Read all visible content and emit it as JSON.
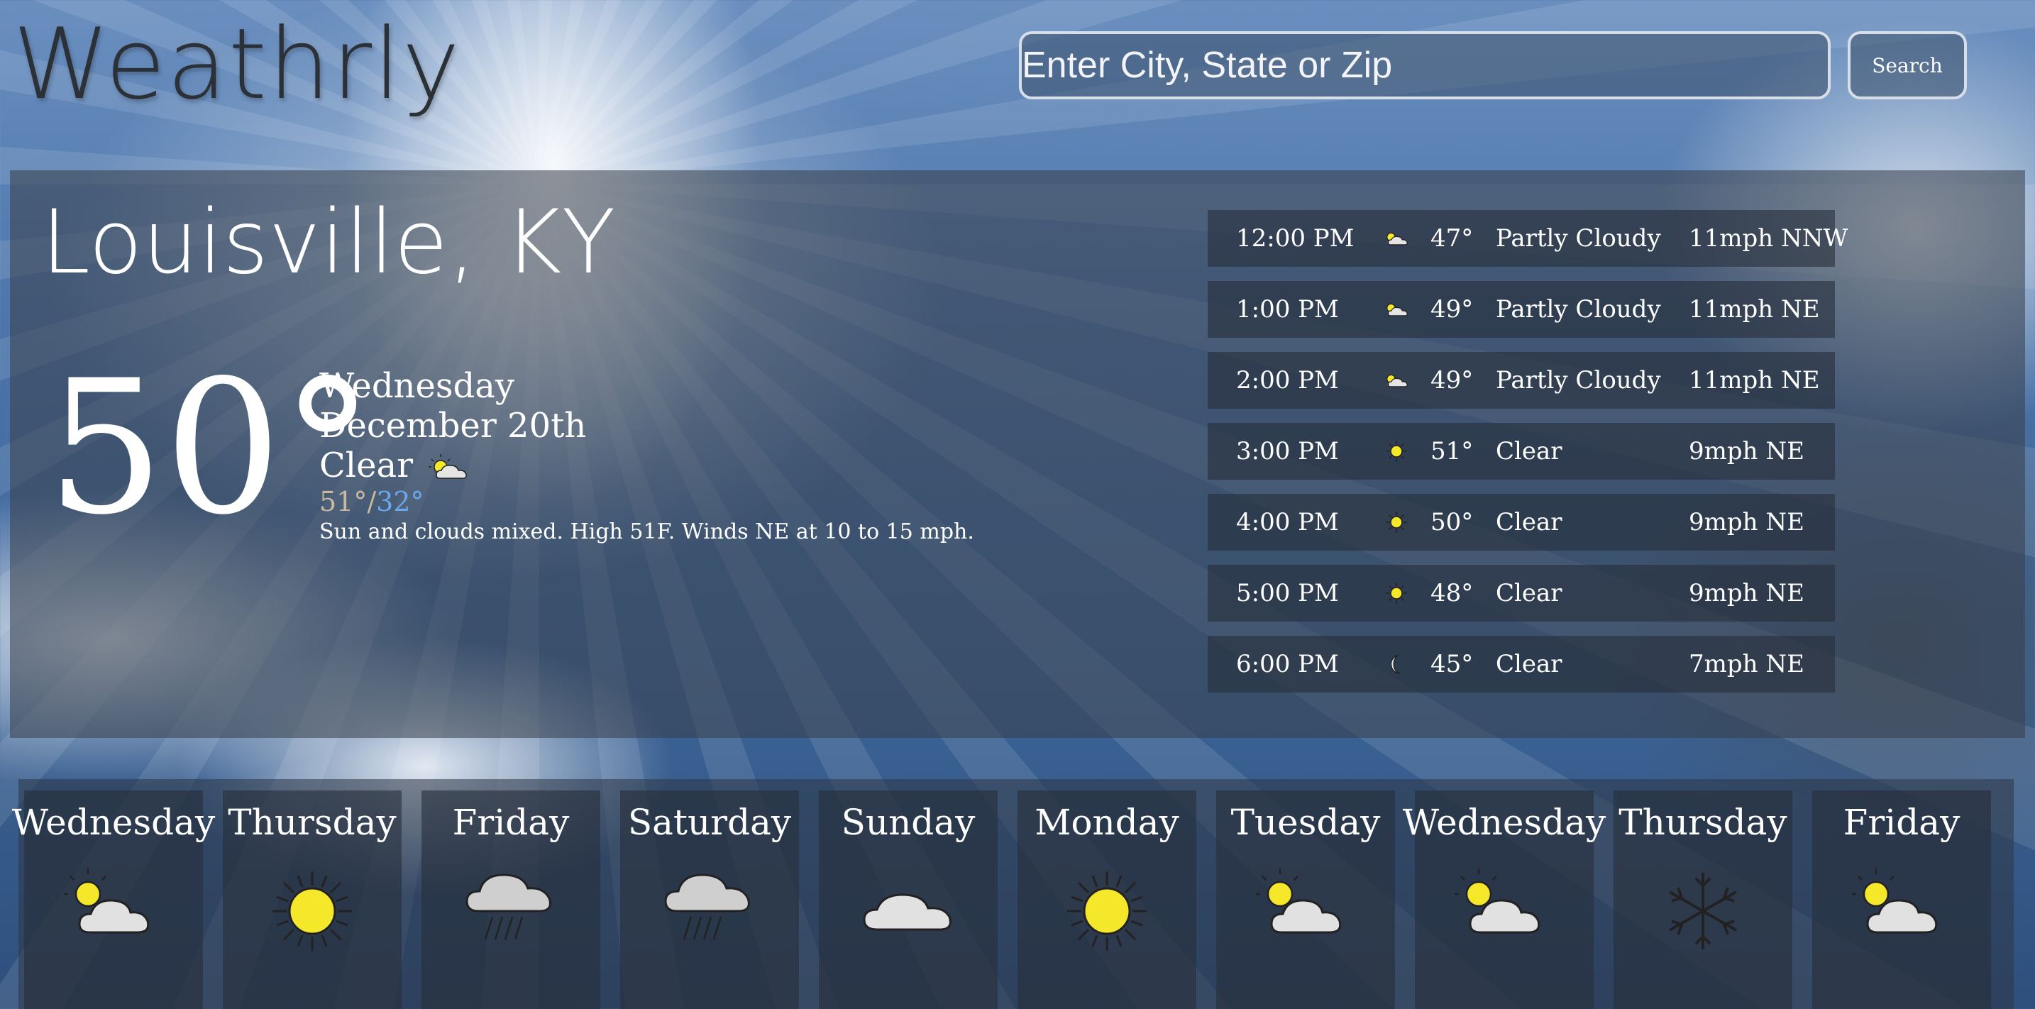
{
  "app": {
    "logo": "Weathrly"
  },
  "search": {
    "placeholder": "Enter City, State or Zip",
    "button_label": "Search"
  },
  "current": {
    "location": "Louisville, KY",
    "temperature": "50°",
    "weekday": "Wednesday",
    "date": "December 20th",
    "condition": "Clear",
    "condition_icon": "partly-cloudy-icon",
    "high": "51°",
    "separator": "/",
    "low": "32°",
    "summary": "Sun and clouds mixed. High 51F. Winds NE at 10 to 15 mph."
  },
  "colors": {
    "high": "#c9b99e",
    "low": "#6aa8ec",
    "logo": "#2c3138"
  },
  "hourly": [
    {
      "time": "12:00 PM",
      "icon": "partly-cloudy-icon",
      "temp": "47°",
      "condition": "Partly Cloudy",
      "wind": "11mph NNW"
    },
    {
      "time": "1:00 PM",
      "icon": "partly-cloudy-icon",
      "temp": "49°",
      "condition": "Partly Cloudy",
      "wind": "11mph NE"
    },
    {
      "time": "2:00 PM",
      "icon": "partly-cloudy-icon",
      "temp": "49°",
      "condition": "Partly Cloudy",
      "wind": "11mph NE"
    },
    {
      "time": "3:00 PM",
      "icon": "sun-icon",
      "temp": "51°",
      "condition": "Clear",
      "wind": "9mph NE"
    },
    {
      "time": "4:00 PM",
      "icon": "sun-icon",
      "temp": "50°",
      "condition": "Clear",
      "wind": "9mph NE"
    },
    {
      "time": "5:00 PM",
      "icon": "sun-icon",
      "temp": "48°",
      "condition": "Clear",
      "wind": "9mph NE"
    },
    {
      "time": "6:00 PM",
      "icon": "moon-icon",
      "temp": "45°",
      "condition": "Clear",
      "wind": "7mph NE"
    }
  ],
  "daily": [
    {
      "day": "Wednesday",
      "icon": "partly-cloudy-icon"
    },
    {
      "day": "Thursday",
      "icon": "sun-icon"
    },
    {
      "day": "Friday",
      "icon": "rain-icon"
    },
    {
      "day": "Saturday",
      "icon": "rain-icon"
    },
    {
      "day": "Sunday",
      "icon": "cloud-icon"
    },
    {
      "day": "Monday",
      "icon": "sun-icon"
    },
    {
      "day": "Tuesday",
      "icon": "partly-cloudy-icon"
    },
    {
      "day": "Wednesday",
      "icon": "partly-cloudy-icon"
    },
    {
      "day": "Thursday",
      "icon": "snowflake-icon"
    },
    {
      "day": "Friday",
      "icon": "partly-cloudy-icon"
    }
  ]
}
